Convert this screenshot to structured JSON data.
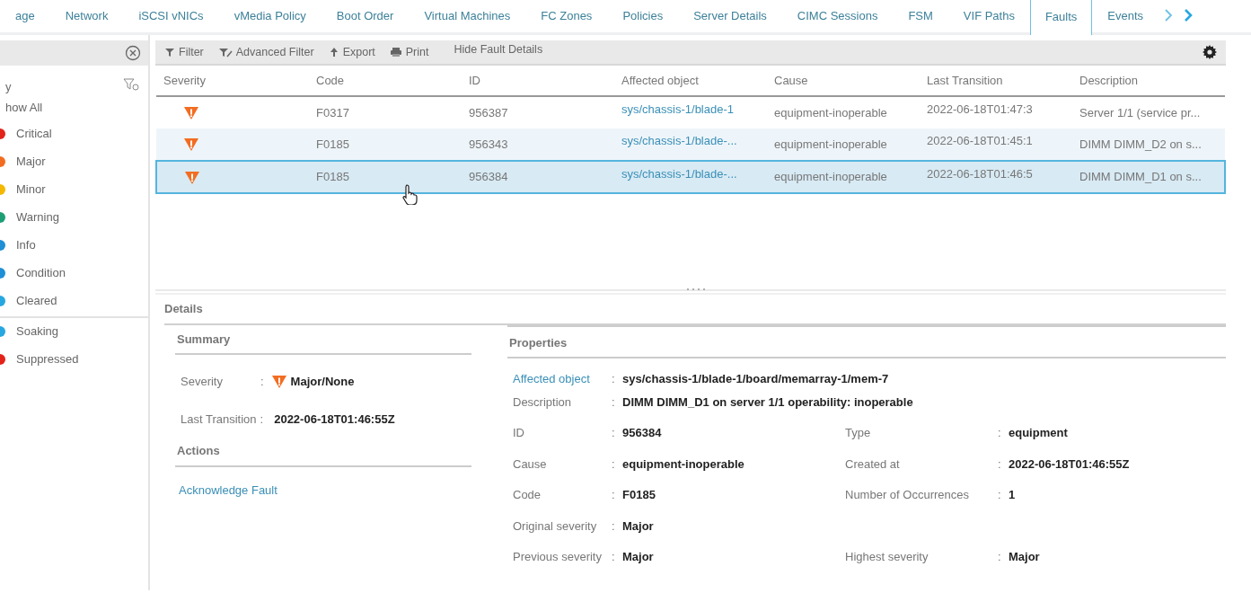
{
  "tabs": [
    {
      "label": "age",
      "selected": false
    },
    {
      "label": "Network",
      "selected": false
    },
    {
      "label": "iSCSI vNICs",
      "selected": false
    },
    {
      "label": "vMedia Policy",
      "selected": false
    },
    {
      "label": "Boot Order",
      "selected": false
    },
    {
      "label": "Virtual Machines",
      "selected": false
    },
    {
      "label": "FC Zones",
      "selected": false
    },
    {
      "label": "Policies",
      "selected": false
    },
    {
      "label": "Server Details",
      "selected": false
    },
    {
      "label": "CIMC Sessions",
      "selected": false
    },
    {
      "label": "FSM",
      "selected": false
    },
    {
      "label": "VIF Paths",
      "selected": false
    },
    {
      "label": "Faults",
      "selected": true
    },
    {
      "label": "Events",
      "selected": false
    }
  ],
  "sidebar": {
    "header": "y",
    "show_all": "how All",
    "groups": [
      {
        "items": [
          {
            "label": "Critical",
            "color": "#e2231a"
          },
          {
            "label": "Major",
            "color": "#f26d21"
          },
          {
            "label": "Minor",
            "color": "#f5b800"
          },
          {
            "label": "Warning",
            "color": "#1e9e75"
          },
          {
            "label": "Info",
            "color": "#1f8fd6"
          },
          {
            "label": "Condition",
            "color": "#1f8fd6"
          },
          {
            "label": "Cleared",
            "color": "#27a7e0"
          }
        ]
      },
      {
        "items": [
          {
            "label": "Soaking",
            "color": "#27a7e0"
          },
          {
            "label": "Suppressed",
            "color": "#e2231a"
          }
        ]
      }
    ]
  },
  "toolbar": [
    {
      "label": "Filter",
      "kind": "filter"
    },
    {
      "label": "Advanced Filter",
      "kind": "advanced-filter"
    },
    {
      "label": "Export",
      "kind": "export"
    },
    {
      "label": "Print",
      "kind": "print"
    },
    {
      "label": "Hide Fault Details",
      "kind": "toggle"
    }
  ],
  "table": {
    "columns": [
      "Severity",
      "Code",
      "ID",
      "Affected object",
      "Cause",
      "Last Transition",
      "Description"
    ],
    "rows": [
      {
        "selected": false,
        "cells": [
          "",
          "F0317",
          "956387",
          "sys/chassis-1/blade-1",
          "equipment-inoperable",
          "2022-06-18T01:47:3",
          "Server 1/1 (service pr..."
        ]
      },
      {
        "selected": false,
        "cells": [
          "",
          "F0185",
          "956343",
          "sys/chassis-1/blade-...",
          "equipment-inoperable",
          "2022-06-18T01:45:1",
          "DIMM DIMM_D2 on s..."
        ]
      },
      {
        "selected": true,
        "cells": [
          "",
          "F0185",
          "956384",
          "sys/chassis-1/blade-...",
          "equipment-inoperable",
          "2022-06-18T01:46:5",
          "DIMM DIMM_D1 on s..."
        ]
      }
    ]
  },
  "details": {
    "title": "Details",
    "separator": ":",
    "summary": {
      "title": "Summary",
      "fields": [
        {
          "label": "Severity",
          "value": "Major/None",
          "kind": "severity"
        },
        {
          "label": "Last Transition",
          "value": "2022-06-18T01:46:55Z",
          "kind": "text"
        }
      ]
    },
    "actions": {
      "title": "Actions",
      "links": [
        "Acknowledge Fault"
      ]
    },
    "properties": {
      "title": "Properties",
      "full_rows": [
        {
          "label": "Affected object",
          "value": "sys/chassis-1/blade-1/board/memarray-1/mem-7",
          "kind": "link"
        },
        {
          "label": "Description",
          "value": "DIMM DIMM_D1 on server 1/1 operability: inoperable",
          "kind": "text"
        }
      ],
      "grid_rows": [
        {
          "left": {
            "label": "ID",
            "value": "956384"
          },
          "right": {
            "label": "Type",
            "value": "equipment"
          }
        },
        {
          "left": {
            "label": "Cause",
            "value": "equipment-inoperable"
          },
          "right": {
            "label": "Created at",
            "value": "2022-06-18T01:46:55Z"
          }
        },
        {
          "left": {
            "label": "Code",
            "value": "F0185"
          },
          "right": {
            "label": "Number of Occurrences",
            "value": "1"
          }
        },
        {
          "left": {
            "label": "Original severity",
            "value": "Major"
          }
        },
        {
          "left": {
            "label": "Previous severity",
            "value": "Major"
          },
          "right": {
            "label": "Highest severity",
            "value": "Major"
          }
        }
      ]
    }
  }
}
